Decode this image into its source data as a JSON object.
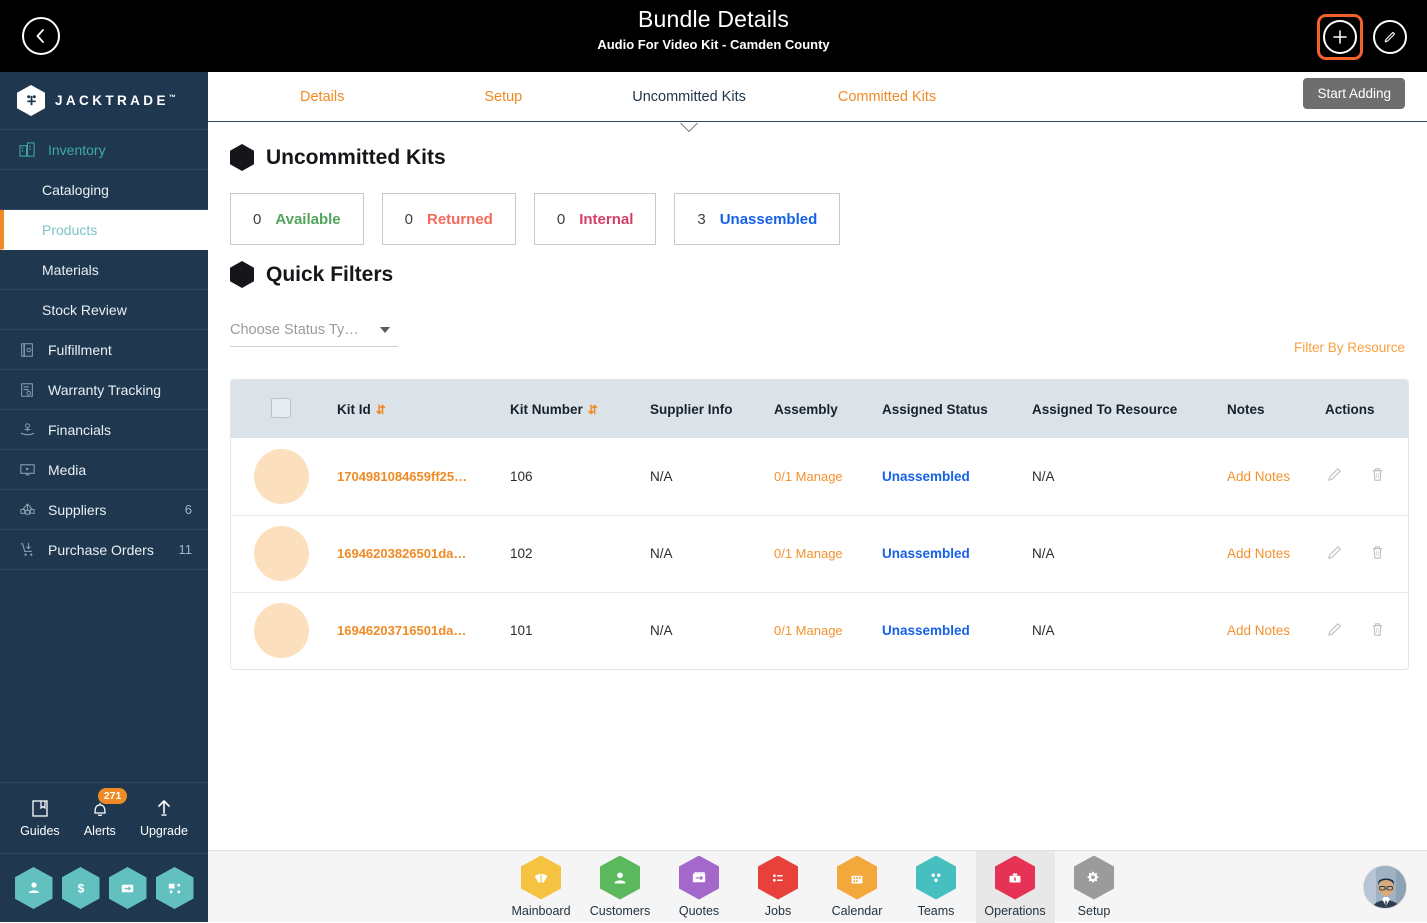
{
  "topbar": {
    "back_icon": "chevron-left-icon",
    "title": "Bundle Details",
    "subtitle": "Audio For Video Kit - Camden County",
    "add_icon": "plus-icon",
    "edit_icon": "pencil-icon"
  },
  "sidebar": {
    "brand": "JACKTRADE",
    "brand_tm": "™",
    "items": [
      {
        "label": "Inventory",
        "icon": "inventory-icon",
        "type": "group",
        "count": ""
      },
      {
        "label": "Cataloging",
        "icon": "",
        "type": "sub",
        "count": ""
      },
      {
        "label": "Products",
        "icon": "",
        "type": "sub",
        "count": "",
        "active": true
      },
      {
        "label": "Materials",
        "icon": "",
        "type": "sub",
        "count": ""
      },
      {
        "label": "Stock Review",
        "icon": "",
        "type": "sub",
        "count": ""
      },
      {
        "label": "Fulfillment",
        "icon": "fulfillment-icon",
        "type": "group",
        "count": ""
      },
      {
        "label": "Warranty Tracking",
        "icon": "warranty-icon",
        "type": "group",
        "count": ""
      },
      {
        "label": "Financials",
        "icon": "financials-icon",
        "type": "group",
        "count": ""
      },
      {
        "label": "Media",
        "icon": "media-icon",
        "type": "group",
        "count": ""
      },
      {
        "label": "Suppliers",
        "icon": "suppliers-icon",
        "type": "group",
        "count": "6"
      },
      {
        "label": "Purchase Orders",
        "icon": "purchase-orders-icon",
        "type": "group",
        "count": "11"
      }
    ],
    "utilities": [
      {
        "label": "Guides",
        "icon": "book-icon",
        "badge": ""
      },
      {
        "label": "Alerts",
        "icon": "bell-icon",
        "badge": "271"
      },
      {
        "label": "Upgrade",
        "icon": "up-arrow-icon",
        "badge": ""
      }
    ],
    "quick_hexes": [
      {
        "icon": "person-icon"
      },
      {
        "icon": "dollar-icon"
      },
      {
        "icon": "money-transfer-icon"
      },
      {
        "icon": "workflow-icon"
      }
    ]
  },
  "tabs": {
    "items": [
      {
        "label": "Details",
        "active": false
      },
      {
        "label": "Setup",
        "active": false
      },
      {
        "label": "Uncommitted Kits",
        "active": true
      },
      {
        "label": "Committed Kits",
        "active": false
      }
    ],
    "start_adding": "Start Adding"
  },
  "main": {
    "section_title": "Uncommitted Kits",
    "quick_filters_title": "Quick Filters",
    "stats": [
      {
        "count": "0",
        "label": "Available",
        "color": "#52A35B"
      },
      {
        "count": "0",
        "label": "Returned",
        "color": "#F26B5B"
      },
      {
        "count": "0",
        "label": "Internal",
        "color": "#D43F6A"
      },
      {
        "count": "3",
        "label": "Unassembled",
        "color": "#1562E8"
      }
    ],
    "status_select_placeholder": "Choose Status Ty…",
    "filter_by_resource": "Filter By Resource"
  },
  "table": {
    "columns": [
      {
        "label": "",
        "sortable": false
      },
      {
        "label": "Kit Id",
        "sortable": true
      },
      {
        "label": "Kit Number",
        "sortable": true
      },
      {
        "label": "Supplier Info",
        "sortable": false
      },
      {
        "label": "Assembly",
        "sortable": false
      },
      {
        "label": "Assigned Status",
        "sortable": false
      },
      {
        "label": "Assigned To Resource",
        "sortable": false
      },
      {
        "label": "Notes",
        "sortable": false
      },
      {
        "label": "Actions",
        "sortable": false
      }
    ],
    "sort_glyph": "⇵",
    "rows": [
      {
        "kit_id": "1704981084659ff25…",
        "kit_number": "106",
        "supplier_info": "N/A",
        "assembly": "0/1 Manage",
        "assigned_status": "Unassembled",
        "assigned_to_resource": "N/A",
        "notes": "Add Notes",
        "edit_icon": "pencil-icon",
        "delete_icon": "trash-icon"
      },
      {
        "kit_id": "16946203826501da…",
        "kit_number": "102",
        "supplier_info": "N/A",
        "assembly": "0/1 Manage",
        "assigned_status": "Unassembled",
        "assigned_to_resource": "N/A",
        "notes": "Add Notes",
        "edit_icon": "pencil-icon",
        "delete_icon": "trash-icon"
      },
      {
        "kit_id": "16946203716501da…",
        "kit_number": "101",
        "supplier_info": "N/A",
        "assembly": "0/1 Manage",
        "assigned_status": "Unassembled",
        "assigned_to_resource": "N/A",
        "notes": "Add Notes",
        "edit_icon": "pencil-icon",
        "delete_icon": "trash-icon"
      }
    ]
  },
  "bottomnav": {
    "items": [
      {
        "label": "Mainboard",
        "icon": "mainboard-icon",
        "color": "#F5C242",
        "active": false
      },
      {
        "label": "Customers",
        "icon": "customers-icon",
        "color": "#5CB85C",
        "active": false
      },
      {
        "label": "Quotes",
        "icon": "quotes-icon",
        "color": "#A368C9",
        "active": false
      },
      {
        "label": "Jobs",
        "icon": "jobs-icon",
        "color": "#E8413C",
        "active": false
      },
      {
        "label": "Calendar",
        "icon": "calendar-icon",
        "color": "#F2A83B",
        "active": false
      },
      {
        "label": "Teams",
        "icon": "teams-icon",
        "color": "#47BFC0",
        "active": false
      },
      {
        "label": "Operations",
        "icon": "operations-icon",
        "color": "#E63355",
        "active": true
      },
      {
        "label": "Setup",
        "icon": "gear-icon",
        "color": "#9B9B9B",
        "active": false
      }
    ],
    "user_avatar": "user-avatar"
  }
}
